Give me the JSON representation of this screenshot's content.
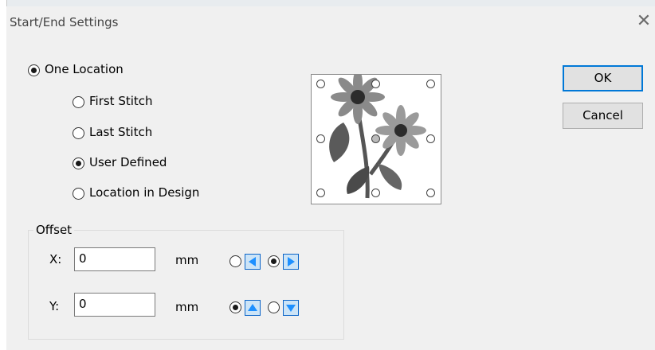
{
  "window": {
    "title": "Start/End Settings",
    "close_icon": "close-icon"
  },
  "location_mode": {
    "label": "One Location",
    "selected": true
  },
  "location_options": [
    {
      "label": "First Stitch",
      "selected": false
    },
    {
      "label": "Last Stitch",
      "selected": false
    },
    {
      "label": "User Defined",
      "selected": true
    },
    {
      "label": "Location in Design",
      "selected": false
    }
  ],
  "buttons": {
    "ok": "OK",
    "cancel": "Cancel"
  },
  "offset": {
    "legend": "Offset",
    "x_label": "X:",
    "x_value": "0",
    "y_label": "Y:",
    "y_value": "0",
    "unit": "mm",
    "x_direction": "right",
    "y_direction": "up"
  },
  "preview": {
    "icon": "flower-design-preview",
    "selected_handle": "center"
  },
  "colors": {
    "accent": "#0078d7",
    "arrow": "#1e90ff",
    "background": "#f0f0f0"
  }
}
